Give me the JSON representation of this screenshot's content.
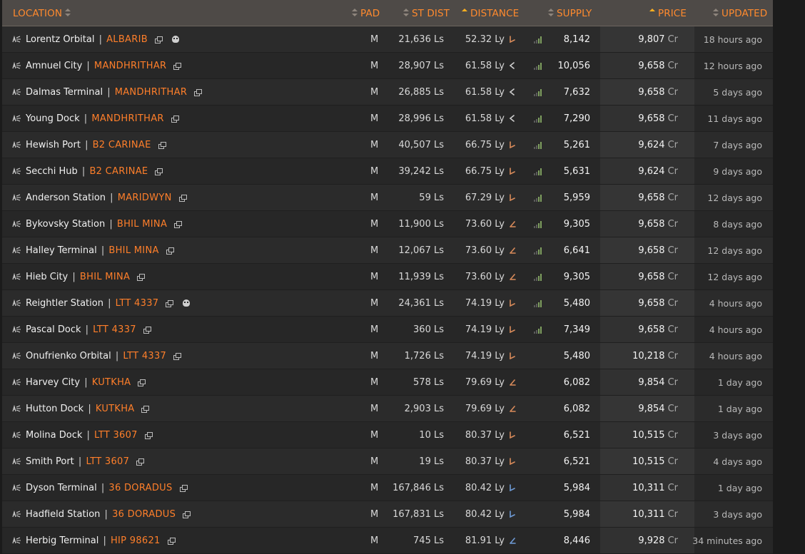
{
  "columns": {
    "location": "LOCATION",
    "pad": "PAD",
    "st_dist": "ST DIST",
    "distance": "DISTANCE",
    "supply": "SUPPLY",
    "price": "PRICE",
    "updated": "UPDATED"
  },
  "sorted_columns": [
    "distance",
    "price"
  ],
  "currency": "Cr",
  "rows": [
    {
      "station": "Lorentz Orbital",
      "system": "ALBARIB",
      "pad": "M",
      "st_dist": "21,636 Ls",
      "distance": "52.32 Ly",
      "supply": "8,142",
      "price": "9,807",
      "updated": "18 hours ago",
      "skull": true,
      "bars": true,
      "dir": "angle-up-left",
      "dir_color": "#d98b5a"
    },
    {
      "station": "Amnuel City",
      "system": "MANDHRITHAR",
      "pad": "M",
      "st_dist": "28,907 Ls",
      "distance": "61.58 Ly",
      "supply": "10,056",
      "price": "9,658",
      "updated": "12 hours ago",
      "skull": false,
      "bars": true,
      "dir": "chevron-left",
      "dir_color": "#cfcfcf"
    },
    {
      "station": "Dalmas Terminal",
      "system": "MANDHRITHAR",
      "pad": "M",
      "st_dist": "26,885 Ls",
      "distance": "61.58 Ly",
      "supply": "7,632",
      "price": "9,658",
      "updated": "5 days ago",
      "skull": false,
      "bars": true,
      "dir": "chevron-left",
      "dir_color": "#cfcfcf"
    },
    {
      "station": "Young Dock",
      "system": "MANDHRITHAR",
      "pad": "M",
      "st_dist": "28,996 Ls",
      "distance": "61.58 Ly",
      "supply": "7,290",
      "price": "9,658",
      "updated": "11 days ago",
      "skull": false,
      "bars": true,
      "dir": "chevron-left",
      "dir_color": "#cfcfcf"
    },
    {
      "station": "Hewish Port",
      "system": "B2 CARINAE",
      "pad": "M",
      "st_dist": "40,507 Ls",
      "distance": "66.75 Ly",
      "supply": "5,261",
      "price": "9,624",
      "updated": "7 days ago",
      "skull": false,
      "bars": true,
      "dir": "angle-up-left",
      "dir_color": "#d98b5a"
    },
    {
      "station": "Secchi Hub",
      "system": "B2 CARINAE",
      "pad": "M",
      "st_dist": "39,242 Ls",
      "distance": "66.75 Ly",
      "supply": "5,631",
      "price": "9,624",
      "updated": "9 days ago",
      "skull": false,
      "bars": true,
      "dir": "angle-up-left",
      "dir_color": "#d98b5a"
    },
    {
      "station": "Anderson Station",
      "system": "MARIDWYN",
      "pad": "M",
      "st_dist": "59 Ls",
      "distance": "67.29 Ly",
      "supply": "5,959",
      "price": "9,658",
      "updated": "12 days ago",
      "skull": false,
      "bars": true,
      "dir": "angle-up-left",
      "dir_color": "#d98b5a"
    },
    {
      "station": "Bykovsky Station",
      "system": "BHIL MINA",
      "pad": "M",
      "st_dist": "11,900 Ls",
      "distance": "73.60 Ly",
      "supply": "9,305",
      "price": "9,658",
      "updated": "8 days ago",
      "skull": false,
      "bars": true,
      "dir": "angle-down-left",
      "dir_color": "#d98b5a"
    },
    {
      "station": "Halley Terminal",
      "system": "BHIL MINA",
      "pad": "M",
      "st_dist": "12,067 Ls",
      "distance": "73.60 Ly",
      "supply": "6,641",
      "price": "9,658",
      "updated": "12 days ago",
      "skull": false,
      "bars": true,
      "dir": "angle-down-left",
      "dir_color": "#d98b5a"
    },
    {
      "station": "Hieb City",
      "system": "BHIL MINA",
      "pad": "M",
      "st_dist": "11,939 Ls",
      "distance": "73.60 Ly",
      "supply": "9,305",
      "price": "9,658",
      "updated": "12 days ago",
      "skull": false,
      "bars": true,
      "dir": "angle-down-left",
      "dir_color": "#d98b5a"
    },
    {
      "station": "Reightler Station",
      "system": "LTT 4337",
      "pad": "M",
      "st_dist": "24,361 Ls",
      "distance": "74.19 Ly",
      "supply": "5,480",
      "price": "9,658",
      "updated": "4 hours ago",
      "skull": true,
      "bars": true,
      "dir": "angle-up-left",
      "dir_color": "#d98b5a"
    },
    {
      "station": "Pascal Dock",
      "system": "LTT 4337",
      "pad": "M",
      "st_dist": "360 Ls",
      "distance": "74.19 Ly",
      "supply": "7,349",
      "price": "9,658",
      "updated": "4 hours ago",
      "skull": false,
      "bars": true,
      "dir": "angle-up-left",
      "dir_color": "#d98b5a"
    },
    {
      "station": "Onufrienko Orbital",
      "system": "LTT 4337",
      "pad": "M",
      "st_dist": "1,726 Ls",
      "distance": "74.19 Ly",
      "supply": "5,480",
      "price": "10,218",
      "updated": "4 hours ago",
      "skull": false,
      "bars": false,
      "dir": "angle-up-left",
      "dir_color": "#d98b5a"
    },
    {
      "station": "Harvey City",
      "system": "KUTKHA",
      "pad": "M",
      "st_dist": "578 Ls",
      "distance": "79.69 Ly",
      "supply": "6,082",
      "price": "9,854",
      "updated": "1 day ago",
      "skull": false,
      "bars": false,
      "dir": "angle-down-left",
      "dir_color": "#d98b5a"
    },
    {
      "station": "Hutton Dock",
      "system": "KUTKHA",
      "pad": "M",
      "st_dist": "2,903 Ls",
      "distance": "79.69 Ly",
      "supply": "6,082",
      "price": "9,854",
      "updated": "1 day ago",
      "skull": false,
      "bars": false,
      "dir": "angle-down-left",
      "dir_color": "#d98b5a"
    },
    {
      "station": "Molina Dock",
      "system": "LTT 3607",
      "pad": "M",
      "st_dist": "10 Ls",
      "distance": "80.37 Ly",
      "supply": "6,521",
      "price": "10,515",
      "updated": "3 days ago",
      "skull": false,
      "bars": false,
      "dir": "angle-up-left",
      "dir_color": "#d98b5a"
    },
    {
      "station": "Smith Port",
      "system": "LTT 3607",
      "pad": "M",
      "st_dist": "19 Ls",
      "distance": "80.37 Ly",
      "supply": "6,521",
      "price": "10,515",
      "updated": "4 days ago",
      "skull": false,
      "bars": false,
      "dir": "angle-up-left",
      "dir_color": "#d98b5a"
    },
    {
      "station": "Dyson Terminal",
      "system": "36 DORADUS",
      "pad": "M",
      "st_dist": "167,846 Ls",
      "distance": "80.42 Ly",
      "supply": "5,984",
      "price": "10,311",
      "updated": "1 day ago",
      "skull": false,
      "bars": false,
      "dir": "angle-up-left",
      "dir_color": "#6e9bd6"
    },
    {
      "station": "Hadfield Station",
      "system": "36 DORADUS",
      "pad": "M",
      "st_dist": "167,831 Ls",
      "distance": "80.42 Ly",
      "supply": "5,984",
      "price": "10,311",
      "updated": "3 days ago",
      "skull": false,
      "bars": false,
      "dir": "angle-up-left",
      "dir_color": "#6e9bd6"
    },
    {
      "station": "Herbig Terminal",
      "system": "HIP 98621",
      "pad": "M",
      "st_dist": "745 Ls",
      "distance": "81.91 Ly",
      "supply": "8,446",
      "price": "9,928",
      "updated": "34 minutes ago",
      "skull": false,
      "bars": false,
      "dir": "angle-down-left",
      "dir_color": "#6e9bd6"
    }
  ]
}
